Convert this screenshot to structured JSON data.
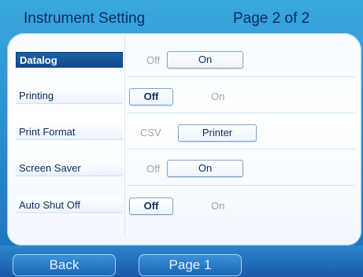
{
  "header": {
    "title": "Instrument Setting",
    "page_indicator": "Page 2 of 2"
  },
  "settings": [
    {
      "label": "Datalog",
      "options": [
        "Off",
        "On"
      ],
      "selected": "On"
    },
    {
      "label": "Printing",
      "options": [
        "Off",
        "On"
      ],
      "selected": "Off"
    },
    {
      "label": "Print Format",
      "options": [
        "CSV",
        "Printer"
      ],
      "selected": "Printer"
    },
    {
      "label": "Screen Saver",
      "options": [
        "Off",
        "On"
      ],
      "selected": "On"
    },
    {
      "label": "Auto Shut Off",
      "options": [
        "Off",
        "On"
      ],
      "selected": "Off"
    }
  ],
  "footer": {
    "back_label": "Back",
    "page1_label": "Page 1"
  },
  "colors": {
    "background_blue": "#2a8fd0",
    "active_label": "#104a8b",
    "text_dark": "#0b2c5c",
    "text_inactive": "#9aa5b3"
  }
}
